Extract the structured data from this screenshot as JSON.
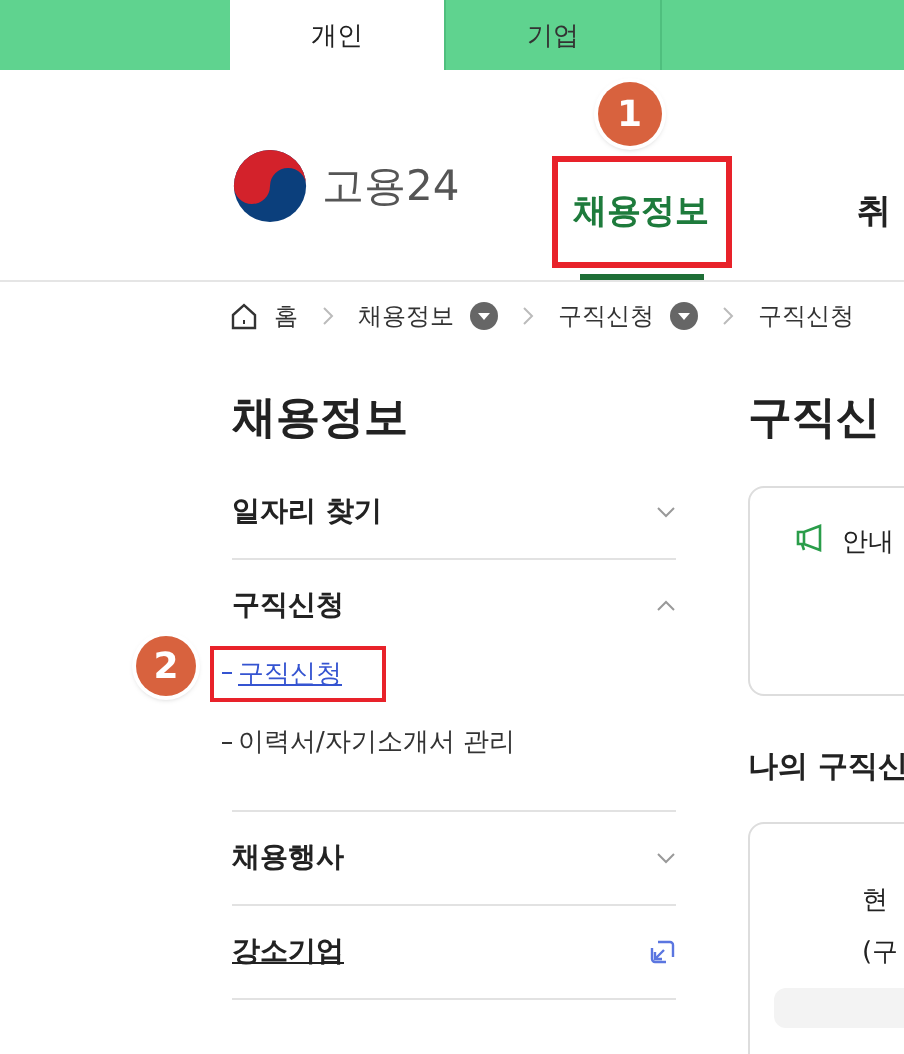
{
  "top_tabs": [
    {
      "label": "개인",
      "selected": true
    },
    {
      "label": "기업",
      "selected": false
    }
  ],
  "logo": {
    "text": "고용24"
  },
  "nav": [
    {
      "label": "채용정보",
      "selected": true,
      "highlighted": true,
      "step": "1"
    },
    {
      "label": "취",
      "selected": false,
      "highlighted": false
    }
  ],
  "breadcrumb": [
    {
      "label": "홈",
      "kind": "home"
    },
    {
      "label": "채용정보",
      "kind": "menu"
    },
    {
      "label": "구직신청",
      "kind": "menu"
    },
    {
      "label": "구직신청",
      "kind": "text"
    }
  ],
  "sidebar": {
    "title": "채용정보",
    "items": [
      {
        "label": "일자리 찾기",
        "kind": "accordion",
        "expanded": false
      },
      {
        "label": "구직신청",
        "kind": "accordion",
        "expanded": true,
        "children": [
          {
            "label": "구직신청",
            "selected": true,
            "highlighted": true,
            "step": "2"
          },
          {
            "label": "이력서/자기소개서 관리",
            "selected": false,
            "highlighted": false
          }
        ]
      },
      {
        "label": "채용행사",
        "kind": "accordion",
        "expanded": false
      },
      {
        "label": "강소기업",
        "kind": "external"
      }
    ]
  },
  "content": {
    "title": "구직신",
    "notice": {
      "label": "안내"
    },
    "section_title": "나의 구직신",
    "card_lines": [
      "현",
      "(구"
    ]
  }
}
